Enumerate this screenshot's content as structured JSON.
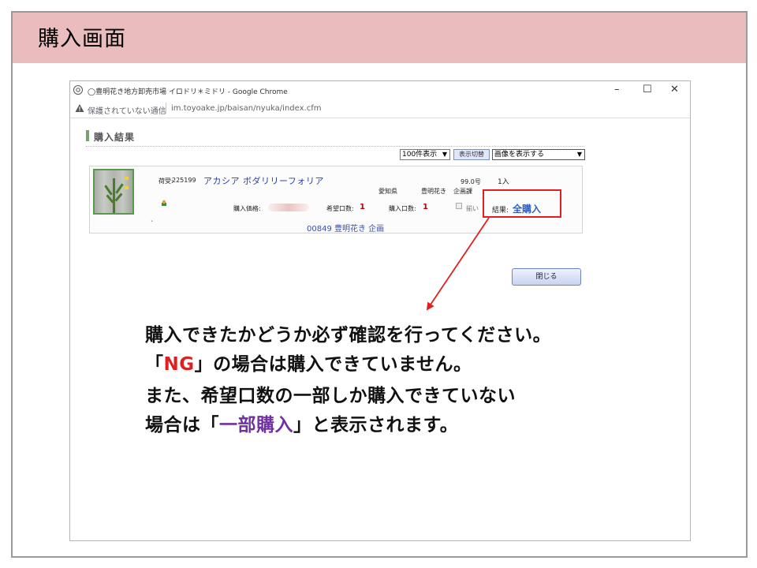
{
  "slide": {
    "title": "購入画面"
  },
  "browser": {
    "window_title": "◯豊明花き地方卸売市場 イロドリ＊ミドリ - Google Chrome",
    "not_secure": "保護されていない通信",
    "url": "im.toyoake.jp/baisan/nyuka/index.cfm",
    "controls": {
      "minimize": "–",
      "maximize": "☐",
      "close": "✕"
    }
  },
  "page": {
    "section_title": "購入結果",
    "per_page_select": "100件表示",
    "toggle_button": "表示切替",
    "image_select": "画像を表示する",
    "close_button": "閉じる"
  },
  "result": {
    "lot_label": "荷受:",
    "lot_number": "225199",
    "product_name": "アカシア ボダリリーフォリア",
    "size": "99.0号",
    "quantity": "1入",
    "prefecture": "愛知県",
    "grower_short": "豊明花き",
    "department": "企画課",
    "price_label": "購入価格:",
    "desired_units_label": "希望口数:",
    "desired_units_value": "1",
    "purchased_units_label": "購入口数:",
    "purchased_units_value": "1",
    "checkbox_label": "揃い",
    "result_label": "結果:",
    "result_value": "全購入",
    "grower_link": "00849 豊明花き 企画",
    "mark": "`"
  },
  "notes": {
    "line1": "購入できたかどうか必ず確認を行ってください。",
    "line2_pre": "「",
    "line2_em": "NG",
    "line2_post": "」の場合は購入できていません。",
    "line3": "また、希望口数の一部しか購入できていない",
    "line4_pre": "場合は「",
    "line4_em": "一部購入",
    "line4_post": "」と表示されます。"
  },
  "colors": {
    "header": "#e9bcbd",
    "highlight": "#e02020",
    "emphasis_red": "#e02020",
    "emphasis_purple": "#7030a0",
    "link_blue": "#2b3fa6"
  },
  "icons": {
    "browser": "chrome-icon",
    "warning": "warning-icon",
    "arrow": "red-arrow"
  }
}
